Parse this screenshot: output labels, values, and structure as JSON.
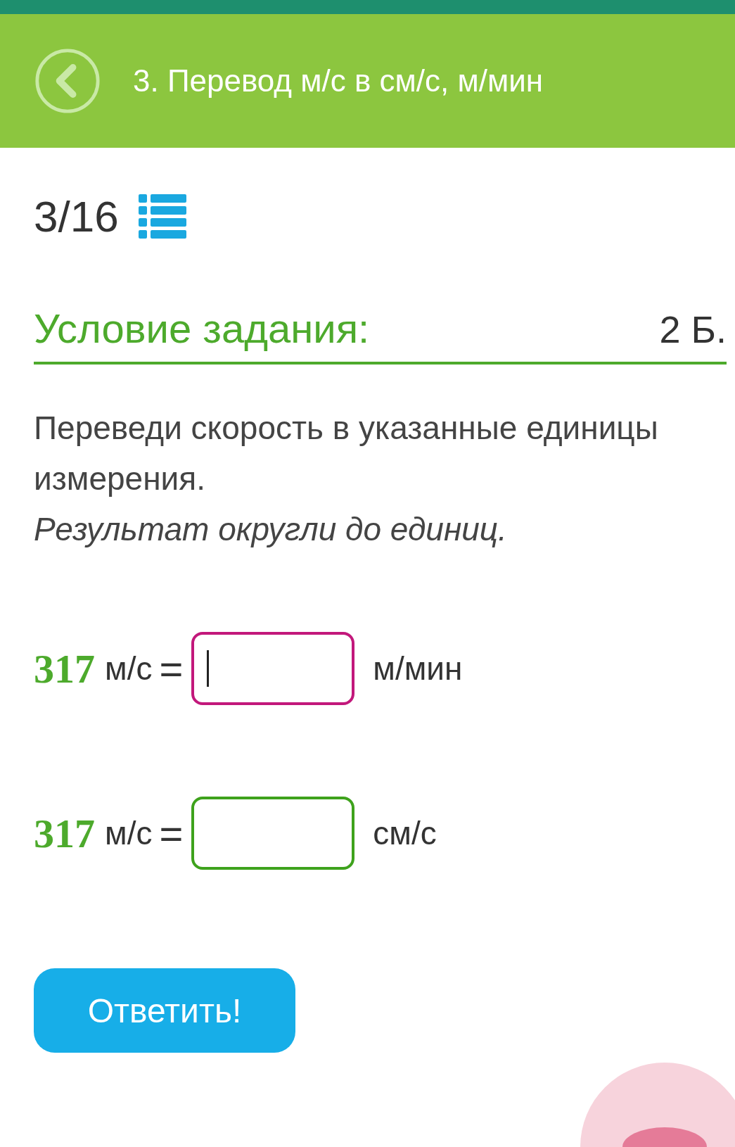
{
  "header": {
    "title": "3. Перевод м/с в см/с, м/мин"
  },
  "progress": {
    "counter": "3/16"
  },
  "task": {
    "heading": "Условие задания:",
    "points": "2 Б.",
    "text": "Переведи скорость в указанные единицы измерения.",
    "note": "Результат округли до единиц."
  },
  "equations": [
    {
      "number": "317",
      "unit_from": "м/с",
      "sign": "=",
      "unit_to": "м/мин",
      "focused": true
    },
    {
      "number": "317",
      "unit_from": "м/с",
      "sign": "=",
      "unit_to": "см/с",
      "focused": false
    }
  ],
  "submit_button": {
    "label": "Ответить!"
  }
}
